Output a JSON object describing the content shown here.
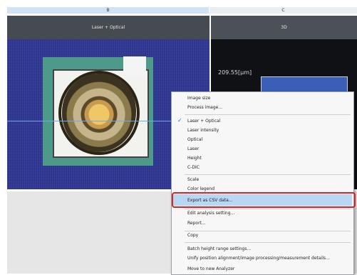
{
  "columns": {
    "b": "B",
    "c": "C"
  },
  "titles": {
    "left": "Laser + Optical",
    "right": "3D"
  },
  "view3d": {
    "measurement": "209.55[μm]"
  },
  "menu": {
    "items": [
      "Image size",
      "Process image...",
      "Laser + Optical",
      "Laser intensity",
      "Optical",
      "Laser",
      "Height",
      "C-DIC",
      "Scale",
      "Color legend",
      "Export as CSV data...",
      "Edit analysis setting...",
      "Report...",
      "Copy",
      "Batch height range settings...",
      "Unify position alignment/image processing/measurement details...",
      "Move to new Analyzer"
    ],
    "checked_item": "Laser + Optical",
    "highlighted_item": "Export as CSV data..."
  },
  "colors": {
    "highlight": "#b9d6f2",
    "callout": "#d3262b",
    "background": "#2f3793"
  }
}
